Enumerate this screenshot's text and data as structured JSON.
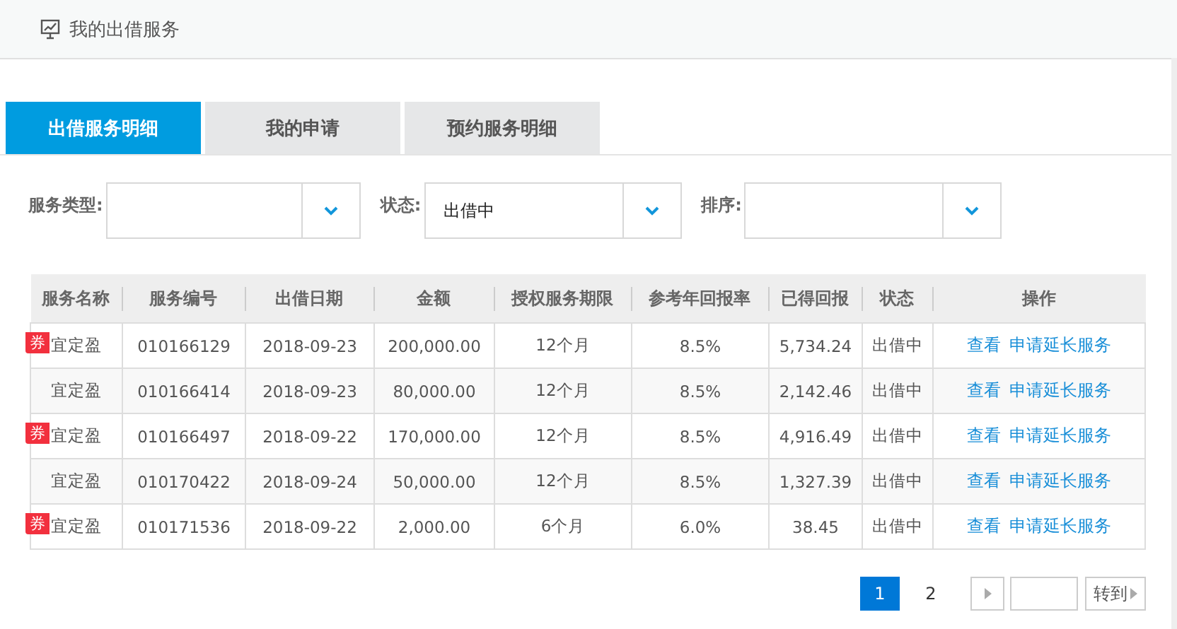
{
  "header": {
    "title": "我的出借服务"
  },
  "tabs": [
    {
      "label": "出借服务明细",
      "selected": true
    },
    {
      "label": "我的申请",
      "selected": false
    },
    {
      "label": "预约服务明细",
      "selected": false
    }
  ],
  "filters": [
    {
      "label": "服务类型:"
    },
    {
      "label": "状态:",
      "value": "出借中"
    },
    {
      "label": "排序:"
    }
  ],
  "table": {
    "columns": [
      "服务名称",
      "服务编号",
      "出借日期",
      "金额",
      "授权服务期限",
      "参考年回报率",
      "已得回报",
      "状态",
      "操作"
    ],
    "rows": [
      {
        "coupon": true,
        "badge": "券",
        "cells": [
          "宜定盈",
          "010166129",
          "2018-09-23",
          "200,000.00",
          "12个月",
          "8.5%",
          "5,734.24",
          "出借中"
        ],
        "actions": [
          "查看",
          "申请延长服务"
        ]
      },
      {
        "coupon": false,
        "cells": [
          "宜定盈",
          "010166414",
          "2018-09-23",
          "80,000.00",
          "12个月",
          "8.5%",
          "2,142.46",
          "出借中"
        ],
        "actions": [
          "查看",
          "申请延长服务"
        ]
      },
      {
        "coupon": true,
        "badge": "券",
        "cells": [
          "宜定盈",
          "010166497",
          "2018-09-22",
          "170,000.00",
          "12个月",
          "8.5%",
          "4,916.49",
          "出借中"
        ],
        "actions": [
          "查看",
          "申请延长服务"
        ]
      },
      {
        "coupon": false,
        "cells": [
          "宜定盈",
          "010170422",
          "2018-09-24",
          "50,000.00",
          "12个月",
          "8.5%",
          "1,327.39",
          "出借中"
        ],
        "actions": [
          "查看",
          "申请延长服务"
        ]
      },
      {
        "coupon": true,
        "badge": "券",
        "cells": [
          "宜定盈",
          "010171536",
          "2018-09-22",
          "2,000.00",
          "6个月",
          "6.0%",
          "38.45",
          "出借中"
        ],
        "actions": [
          "查看",
          "申请延长服务"
        ]
      }
    ]
  },
  "pagination": {
    "pages": [
      {
        "label": "1",
        "selected": true
      },
      {
        "label": "2",
        "selected": false
      }
    ],
    "go_button": "转到"
  }
}
